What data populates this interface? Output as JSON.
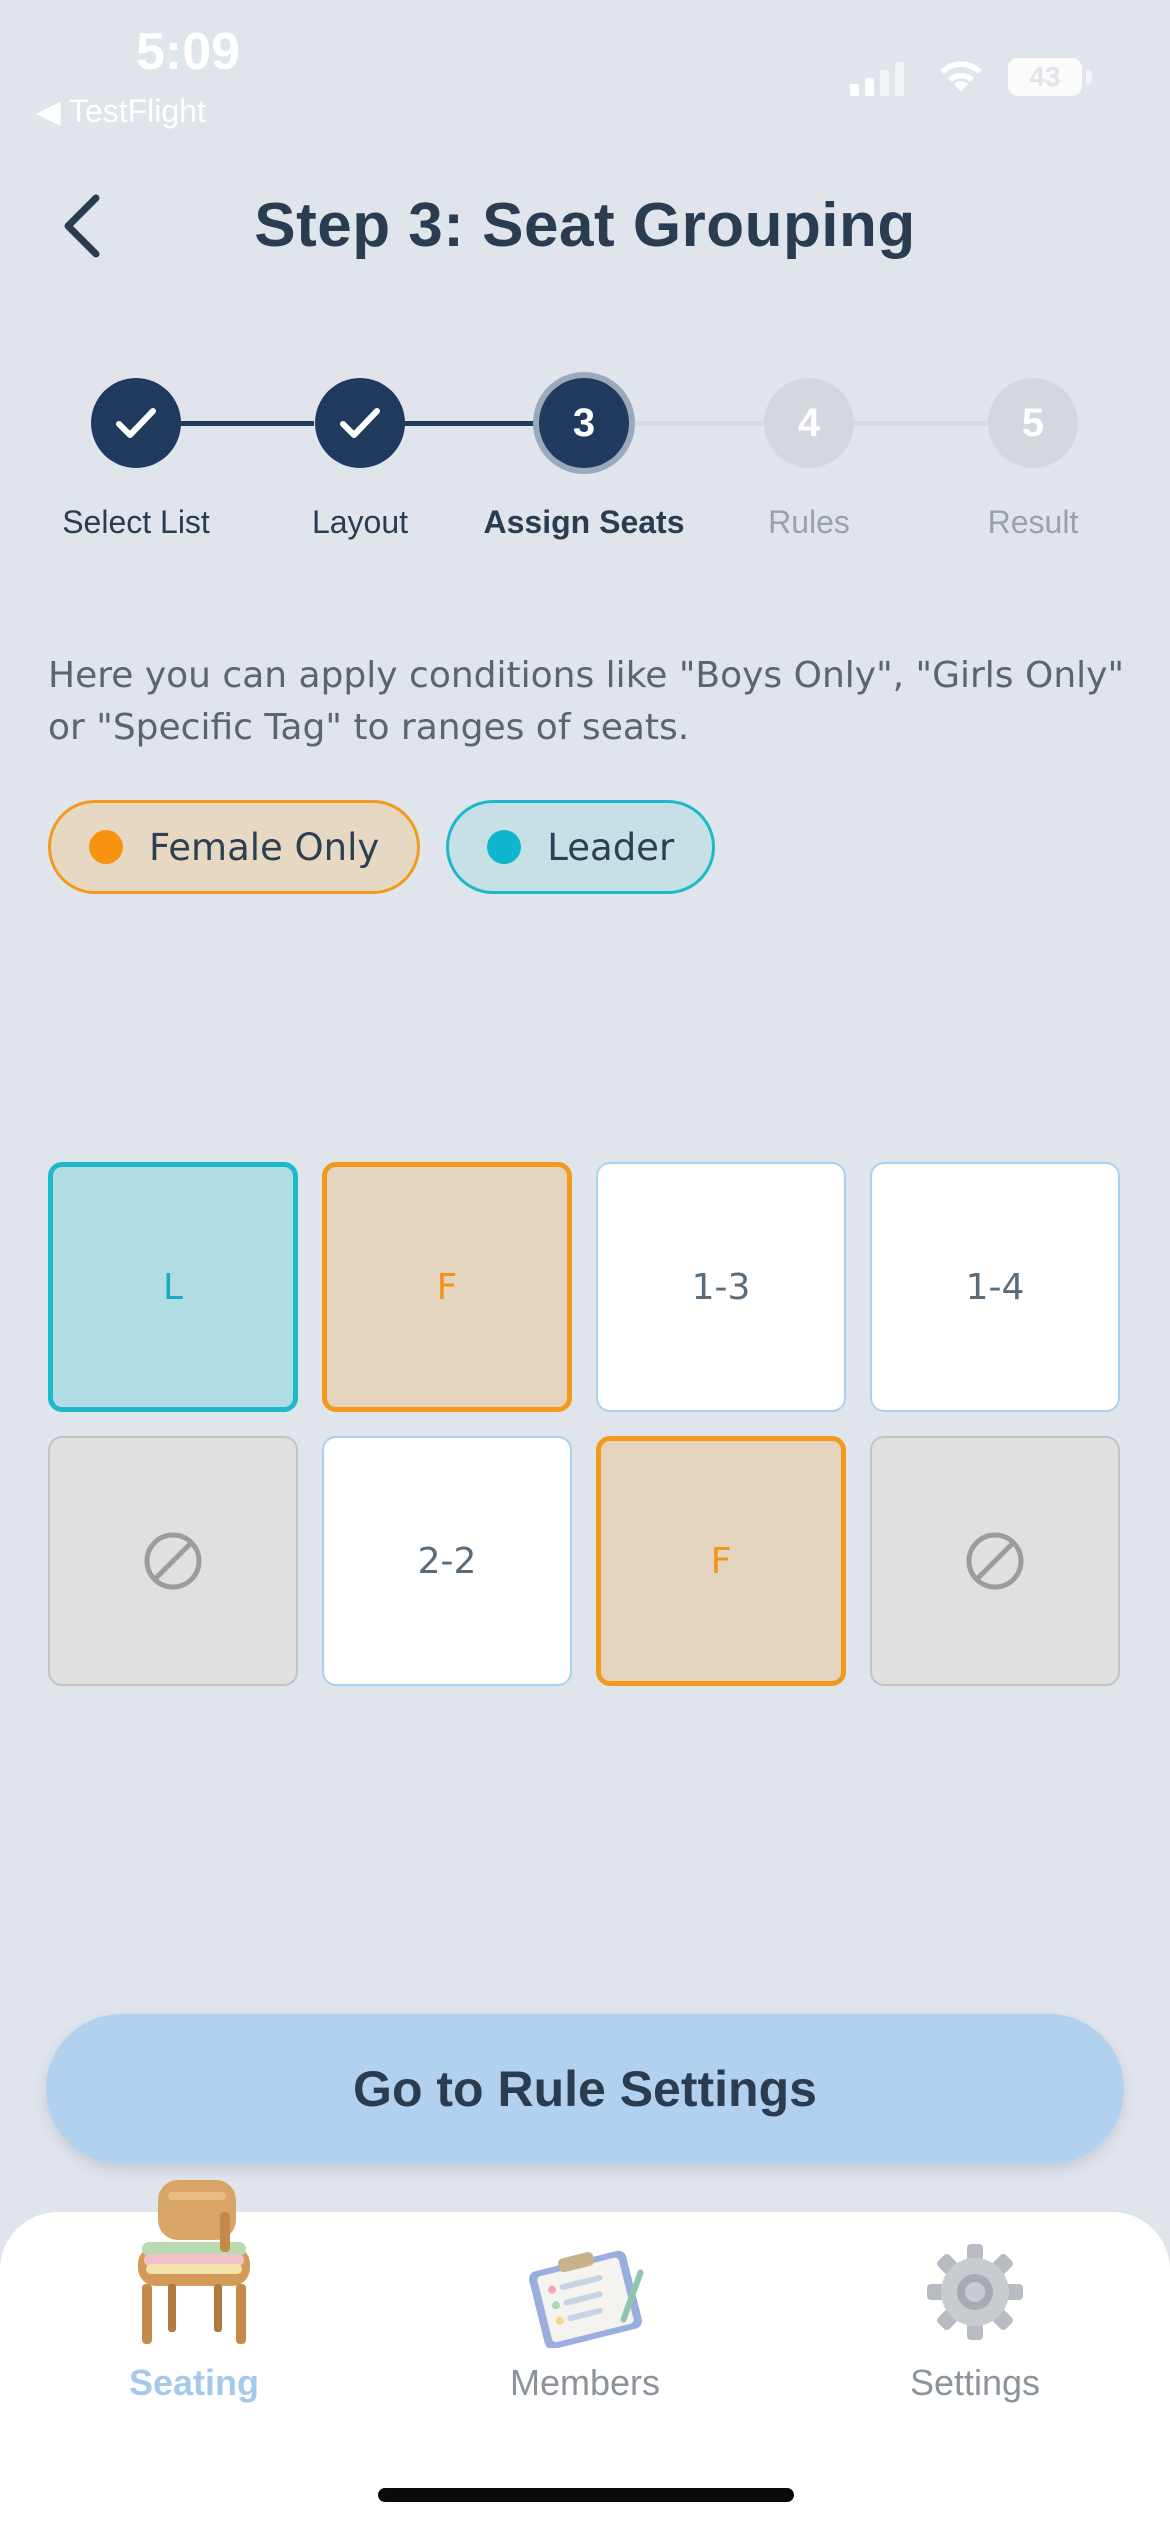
{
  "status_bar": {
    "time": "5:09",
    "back_app": "◀ TestFlight",
    "battery": "43"
  },
  "header": {
    "title": "Step 3: Seat Grouping",
    "back_icon": "chevron-left-icon"
  },
  "stepper": {
    "steps": [
      {
        "label": "Select List",
        "number": "1",
        "state": "done"
      },
      {
        "label": "Layout",
        "number": "2",
        "state": "done"
      },
      {
        "label": "Assign Seats",
        "number": "3",
        "state": "active"
      },
      {
        "label": "Rules",
        "number": "4",
        "state": "todo"
      },
      {
        "label": "Result",
        "number": "5",
        "state": "todo"
      }
    ]
  },
  "description": "Here you can apply conditions like \"Boys Only\", \"Girls Only\" or \"Specific Tag\" to ranges of seats.",
  "chips": [
    {
      "label": "Female Only",
      "color": "#f7930f"
    },
    {
      "label": "Leader",
      "color": "#0fb6cd"
    }
  ],
  "seats": [
    [
      {
        "label": "L",
        "type": "leader"
      },
      {
        "label": "F",
        "type": "female"
      },
      {
        "label": "1-3",
        "type": "empty"
      },
      {
        "label": "1-4",
        "type": "empty"
      }
    ],
    [
      {
        "label": "",
        "type": "blocked",
        "icon": "blocked-icon"
      },
      {
        "label": "2-2",
        "type": "empty"
      },
      {
        "label": "F",
        "type": "female"
      },
      {
        "label": "",
        "type": "blocked",
        "icon": "blocked-icon"
      }
    ]
  ],
  "cta": {
    "label": "Go to Rule Settings"
  },
  "tabbar": {
    "tabs": [
      {
        "label": "Seating",
        "icon": "chair-icon",
        "active": true
      },
      {
        "label": "Members",
        "icon": "clipboard-icon",
        "active": false
      },
      {
        "label": "Settings",
        "icon": "gear-icon",
        "active": false
      }
    ]
  },
  "colors": {
    "background": "#e0e4eb",
    "primary": "#1f3a5c",
    "female": "#f39a1e",
    "leader": "#1cb8cc",
    "cta": "#b2d1ee"
  }
}
